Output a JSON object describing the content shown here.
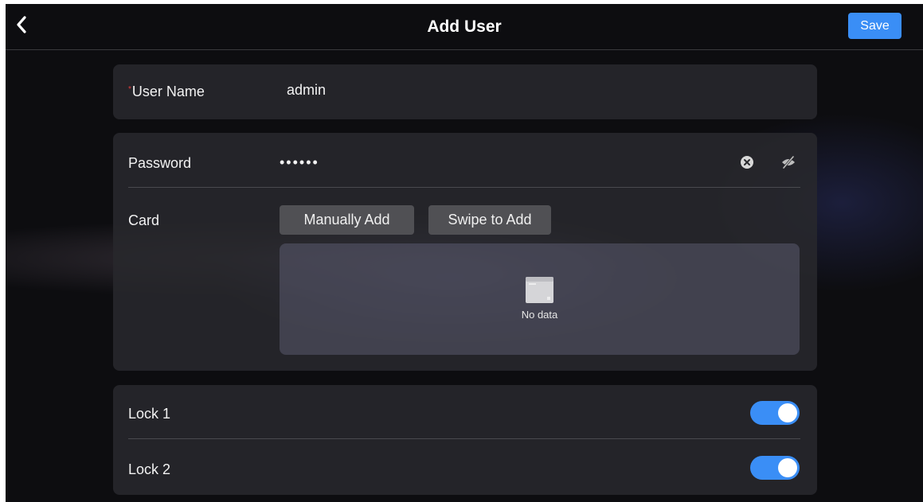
{
  "header": {
    "title": "Add User",
    "save_label": "Save",
    "back_icon": "chevron-left-icon"
  },
  "user_name": {
    "label": "User Name",
    "required_mark": "*",
    "value": "admin"
  },
  "password": {
    "label": "Password",
    "masked_value": "••••••",
    "clear_icon": "clear-circle-icon",
    "visibility_icon": "eye-off-icon"
  },
  "card": {
    "label": "Card",
    "manual_add_label": "Manually Add",
    "swipe_add_label": "Swipe to Add",
    "empty_icon": "empty-folder-icon",
    "empty_text": "No data"
  },
  "locks": [
    {
      "label": "Lock 1",
      "enabled": true
    },
    {
      "label": "Lock 2",
      "enabled": true
    }
  ],
  "colors": {
    "accent": "#3a8ef6",
    "required": "#e23b3b",
    "background": "#0d0d10",
    "panel": "#28282c"
  }
}
